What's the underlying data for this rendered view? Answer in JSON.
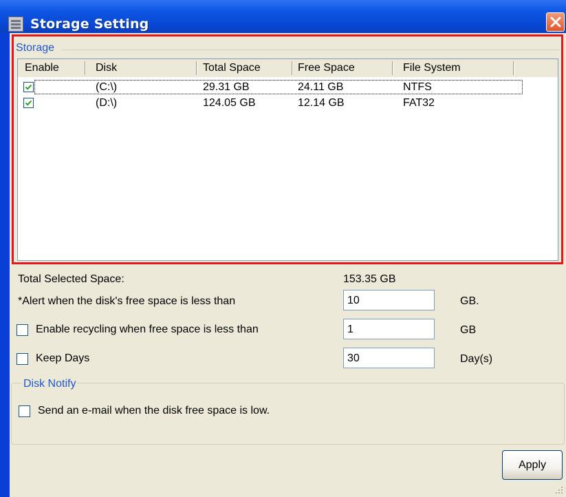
{
  "window": {
    "title": "Storage Setting"
  },
  "storage": {
    "legend": "Storage",
    "columns": [
      "Enable",
      "Disk",
      "Total Space",
      "Free Space",
      "File System"
    ],
    "rows": [
      {
        "enabled": true,
        "disk": "(C:\\)",
        "total": "29.31 GB",
        "free": "24.11 GB",
        "fs": "NTFS"
      },
      {
        "enabled": true,
        "disk": "(D:\\)",
        "total": "124.05 GB",
        "free": "12.14 GB",
        "fs": "FAT32"
      }
    ]
  },
  "settings": {
    "total_selected_label": "Total Selected Space:",
    "total_selected_value": "153.35 GB",
    "alert_label": "*Alert when the disk's free space is less than",
    "alert_value": "10",
    "alert_unit": "GB.",
    "recycle_label": "Enable recycling when free space is less than",
    "recycle_checked": false,
    "recycle_value": "1",
    "recycle_unit": "GB",
    "keep_label": "Keep Days",
    "keep_checked": false,
    "keep_value": "30",
    "keep_unit": "Day(s)"
  },
  "notify": {
    "legend": "Disk Notify",
    "email_label": "Send an e-mail when the disk free space is low.",
    "email_checked": false
  },
  "buttons": {
    "apply": "Apply"
  },
  "colors": {
    "title_bar": "#0a54e0",
    "highlight_border": "#e8141e",
    "legend_text": "#2157c9",
    "dialog_bg": "#ece9d8"
  }
}
